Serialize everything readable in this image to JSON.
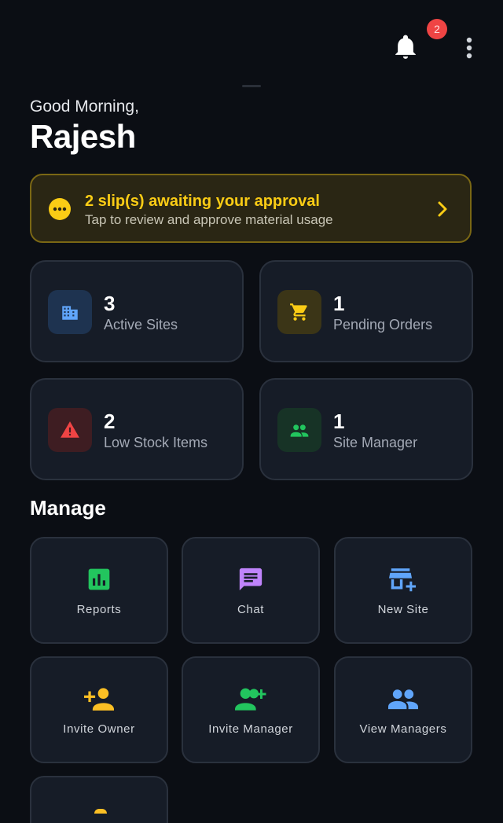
{
  "header": {
    "notification_count": "2"
  },
  "greeting": {
    "salutation": "Good Morning,",
    "name": "Rajesh"
  },
  "approval_banner": {
    "title": "2 slip(s) awaiting your approval",
    "subtitle": "Tap to review and approve material usage"
  },
  "stats": [
    {
      "value": "3",
      "label": "Active Sites",
      "icon": "building-icon"
    },
    {
      "value": "1",
      "label": "Pending Orders",
      "icon": "cart-icon"
    },
    {
      "value": "2",
      "label": "Low Stock Items",
      "icon": "warning-icon"
    },
    {
      "value": "1",
      "label": "Site Manager",
      "icon": "people-icon"
    }
  ],
  "manage": {
    "title": "Manage",
    "tiles": [
      {
        "label": "Reports",
        "icon": "bar-chart-icon"
      },
      {
        "label": "Chat",
        "icon": "chat-icon"
      },
      {
        "label": "New Site",
        "icon": "add-store-icon"
      },
      {
        "label": "Invite Owner",
        "icon": "person-add-icon"
      },
      {
        "label": "Invite Manager",
        "icon": "group-add-icon"
      },
      {
        "label": "View Managers",
        "icon": "people-icon"
      }
    ]
  },
  "colors": {
    "background": "#0b0e14",
    "card": "#161c27",
    "accent_yellow": "#facc15",
    "badge_red": "#ef4444",
    "blue": "#60a5fa",
    "green": "#22c55e",
    "purple": "#c084fc"
  }
}
